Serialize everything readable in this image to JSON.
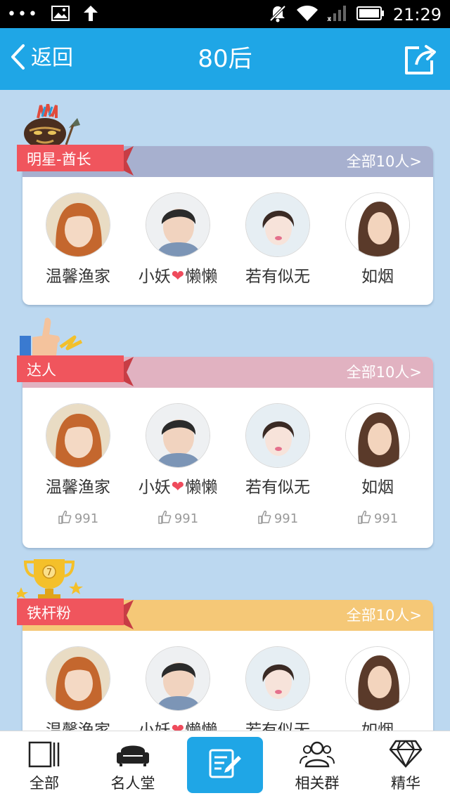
{
  "status_bar": {
    "time": "21:29",
    "dots": "•••"
  },
  "nav": {
    "back_label": "返回",
    "title": "80后"
  },
  "sections": [
    {
      "title": "明星-酋长",
      "more": "全部10人>",
      "head_color": "#a7b0cf",
      "badge": "chief-mask",
      "members": [
        {
          "name": "温馨渔家"
        },
        {
          "name_a": "小妖",
          "name_b": "懒懒"
        },
        {
          "name": "若有似无"
        },
        {
          "name": "如烟"
        }
      ]
    },
    {
      "title": "达人",
      "more": "全部10人>",
      "head_color": "#e1b2c1",
      "badge": "thumbs-up",
      "members": [
        {
          "name": "温馨渔家",
          "likes": "991"
        },
        {
          "name_a": "小妖",
          "name_b": "懒懒",
          "likes": "991"
        },
        {
          "name": "若有似无",
          "likes": "991"
        },
        {
          "name": "如烟",
          "likes": "991"
        }
      ]
    },
    {
      "title": "铁杆粉",
      "more": "全部10人>",
      "head_color": "#f5c877",
      "badge": "trophy",
      "trophy_number": "7",
      "members": [
        {
          "name": "温馨渔家"
        },
        {
          "name_a": "小妖",
          "name_b": "懒懒"
        },
        {
          "name": "若有似无"
        },
        {
          "name": "如烟"
        }
      ]
    }
  ],
  "tabs": [
    {
      "label": "全部",
      "icon": "panels-icon"
    },
    {
      "label": "名人堂",
      "icon": "sofa-icon"
    },
    {
      "label": "",
      "icon": "compose-icon",
      "active": true
    },
    {
      "label": "相关群",
      "icon": "group-icon"
    },
    {
      "label": "精华",
      "icon": "diamond-icon"
    }
  ],
  "colors": {
    "accent": "#1fa6e6",
    "ribbon": "#f0555d",
    "background": "#bcd8f0"
  }
}
